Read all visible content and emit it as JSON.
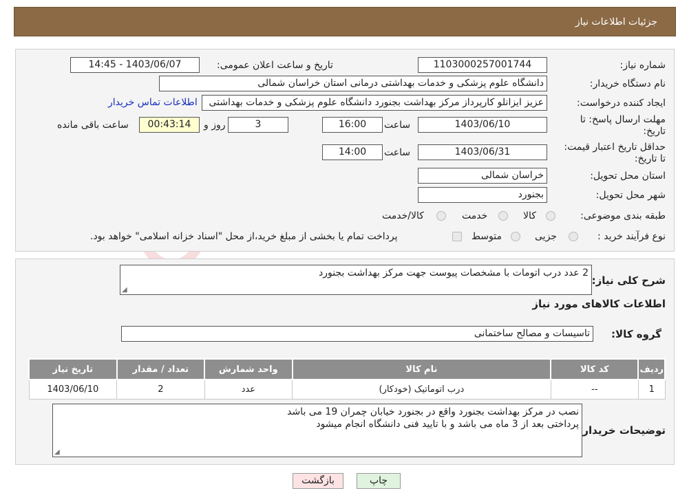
{
  "header": {
    "title": "جزئیات اطلاعات نیاز"
  },
  "form": {
    "need_number_label": "شماره نیاز:",
    "need_number": "1103000257001744",
    "announce_label": "تاریخ و ساعت اعلان عمومی:",
    "announce_value": "1403/06/07 - 14:45",
    "buyer_org_label": "نام دستگاه خریدار:",
    "buyer_org": "دانشگاه علوم پزشکی و خدمات بهداشتی درمانی استان خراسان شمالی",
    "creator_label": "ایجاد کننده درخواست:",
    "creator": "عزیز ایزانلو کارپرداز مرکز بهداشت بجنورد دانشگاه علوم پزشکی و خدمات بهداشتی",
    "contact_link": "اطلاعات تماس خریدار",
    "deadline_label": "مهلت ارسال پاسخ: تا تاریخ:",
    "deadline_date": "1403/06/10",
    "time_label": "ساعت",
    "deadline_time": "16:00",
    "days_value": "3",
    "days_label": "روز و",
    "remaining_time": "00:43:14",
    "remaining_label": "ساعت باقی مانده",
    "validity_label": "حداقل تاریخ اعتبار قیمت: تا تاریخ:",
    "validity_date": "1403/06/31",
    "validity_time": "14:00",
    "province_label": "استان محل تحویل:",
    "province": "خراسان شمالی",
    "city_label": "شهر محل تحویل:",
    "city": "بجنورد",
    "category_label": "طبقه بندی موضوعی:",
    "category_options": [
      "کالا",
      "خدمت",
      "کالا/خدمت"
    ],
    "process_label": "نوع فرآیند خرید :",
    "process_options": [
      "جزیی",
      "متوسط"
    ],
    "process_note": "پرداخت تمام یا بخشی از مبلغ خرید،از محل \"اسناد خزانه اسلامی\" خواهد بود."
  },
  "details": {
    "summary_label": "شرح کلی نیاز:",
    "summary": "2 عدد درب اتومات با مشخصات پیوست جهت مرکز بهداشت بجنورد",
    "goods_info_title": "اطلاعات کالاهای مورد نیاز",
    "group_label": "گروه کالا:",
    "group_value": "تاسیسات و مصالح ساختمانی",
    "table": {
      "headers": [
        "ردیف",
        "کد کالا",
        "نام کالا",
        "واحد شمارش",
        "تعداد / مقدار",
        "تاریخ نیاز"
      ],
      "rows": [
        [
          "1",
          "--",
          "درب اتوماتیک (خودکار)",
          "عدد",
          "2",
          "1403/06/10"
        ]
      ]
    },
    "buyer_notes_label": "توضیحات خریدار:",
    "buyer_notes_line1": "نصب در مرکز بهداشت بجنورد واقع در بجنورد خیابان چمران 19 می باشد",
    "buyer_notes_line2": "پرداختی بعد از 3 ماه می باشد و با تایید فنی دانشگاه انجام میشود"
  },
  "buttons": {
    "back": "بازگشت",
    "print": "چاپ"
  },
  "colors": {
    "header_bg": "#8b6a45",
    "table_header_bg": "#8e8e8e",
    "link": "#1a2fbf"
  }
}
